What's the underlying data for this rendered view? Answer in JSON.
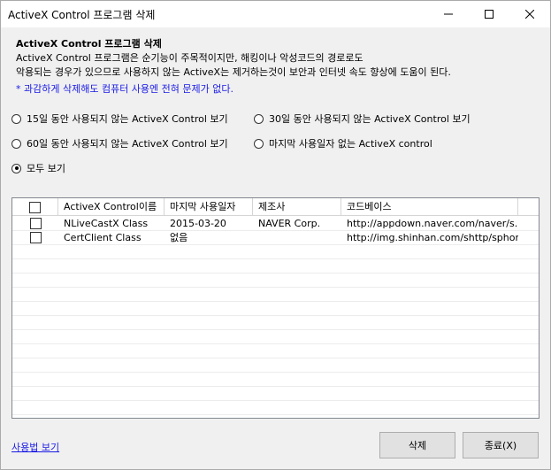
{
  "window": {
    "title": "ActiveX Control 프로그램 삭제",
    "icons": {
      "minimize": "minimize-icon",
      "maximize": "maximize-icon",
      "close": "close-icon"
    }
  },
  "intro": {
    "heading": "ActiveX Control 프로그램 삭제",
    "line1": "ActiveX Control 프로그램은 순기능이 주목적이지만, 해킹이나 악성코드의 경로로도",
    "line2": "악용되는 경우가 있으므로 사용하지 않는 ActiveX는 제거하는것이 보안과 인터넷 속도 향상에 도움이 된다.",
    "note": "* 과감하게 삭제해도 컴퓨터 사용엔 전혀 문제가 없다."
  },
  "filters": {
    "options": [
      {
        "label": "15일 동안 사용되지 않는 ActiveX Control 보기",
        "checked": false
      },
      {
        "label": "30일 동안 사용되지 않는 ActiveX Control 보기",
        "checked": false
      },
      {
        "label": "60일 동안 사용되지 않는 ActiveX Control 보기",
        "checked": false
      },
      {
        "label": "마지막 사용일자 없는 ActiveX control",
        "checked": false
      },
      {
        "label": "모두 보기",
        "checked": true
      }
    ]
  },
  "table": {
    "columns": [
      "ActiveX Control이름",
      "마지막 사용일자",
      "제조사",
      "코드베이스"
    ],
    "rows": [
      {
        "name": "NLiveCastX Class",
        "last_used": "2015-03-20",
        "vendor": "NAVER Corp.",
        "codebase": "http://appdown.naver.com/naver/s...",
        "checked": false
      },
      {
        "name": "CertClient Class",
        "last_used": "없음",
        "vendor": "",
        "codebase": "http://img.shinhan.com/shttp/sphon...",
        "checked": false
      }
    ]
  },
  "footer": {
    "help_link": "사용법 보기",
    "delete_button": "삭제",
    "close_button": "종료(X)"
  }
}
